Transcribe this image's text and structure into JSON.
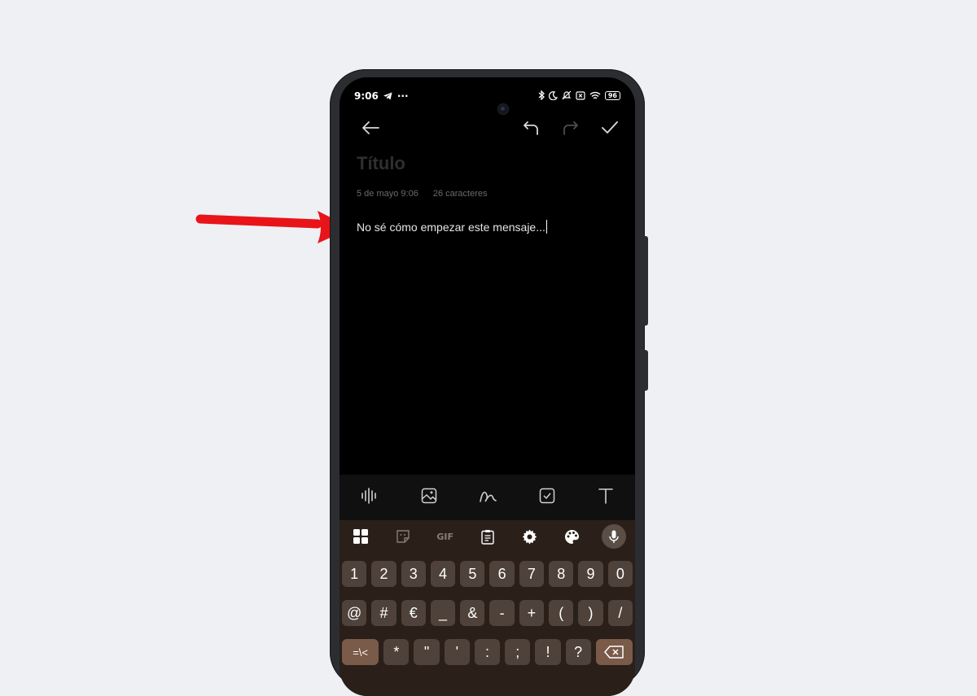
{
  "status_bar": {
    "time": "9:06",
    "more": "···",
    "battery": "96"
  },
  "toolbar": {
    "back_icon": "arrow-left-icon",
    "undo_icon": "undo-icon",
    "redo_icon": "redo-icon",
    "save_icon": "check-icon"
  },
  "note": {
    "title_placeholder": "Título",
    "date": "5 de mayo 9:06",
    "char_count": "26 caracteres",
    "content": "No sé cómo empezar este mensaje..."
  },
  "note_tools": [
    "audio-waveform-icon",
    "image-icon",
    "scribble-icon",
    "checklist-icon",
    "text-format-icon"
  ],
  "keyboard": {
    "toolbar": [
      "apps-grid-icon",
      "sticker-icon",
      "GIF",
      "clipboard-icon",
      "gear-icon",
      "palette-icon",
      "microphone-icon"
    ],
    "gif_label": "GIF",
    "numbers": [
      "1",
      "2",
      "3",
      "4",
      "5",
      "6",
      "7",
      "8",
      "9",
      "0"
    ],
    "symbols1": [
      "@",
      "#",
      "€",
      "_",
      "&",
      "-",
      "+",
      "(",
      ")",
      "/"
    ],
    "symbols2": [
      "=\\<",
      "*",
      "\"",
      "'",
      ":",
      ";",
      "!",
      "?"
    ],
    "colors": {
      "background": "#2b1f19",
      "key": "#4e423b",
      "accent_key": "#7a5a49"
    }
  },
  "annotation": {
    "arrow_color": "#e8141a"
  }
}
